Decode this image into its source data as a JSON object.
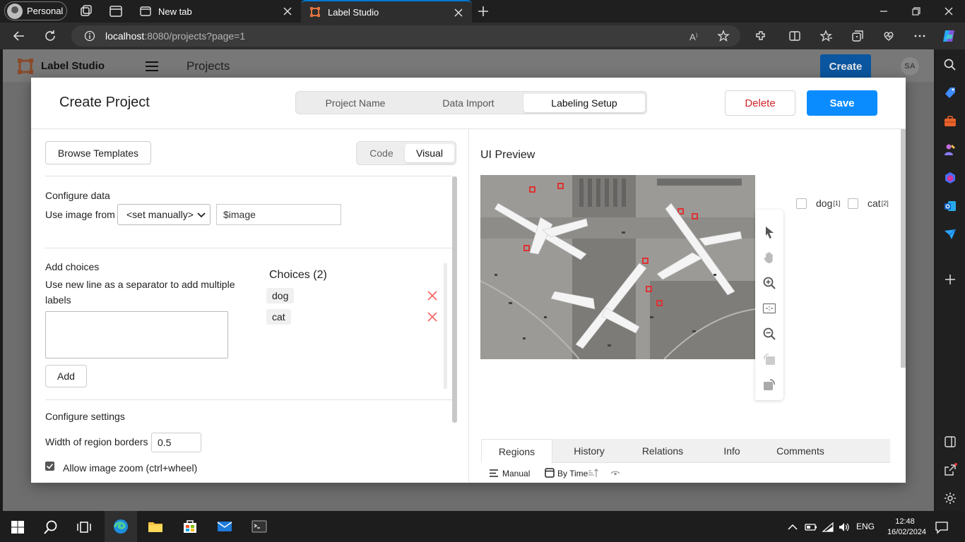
{
  "browser": {
    "profile_label": "Personal",
    "tabs": [
      {
        "title": "New tab",
        "active": false
      },
      {
        "title": "Label Studio",
        "active": true
      }
    ],
    "url_host": "localhost",
    "url_rest": ":8080/projects?page=1"
  },
  "app": {
    "name": "Label Studio",
    "breadcrumb": "Projects",
    "create_label": "Create",
    "user_initials": "SA"
  },
  "modal": {
    "title": "Create Project",
    "steps": [
      "Project Name",
      "Data Import",
      "Labeling Setup"
    ],
    "active_step": "Labeling Setup",
    "delete_label": "Delete",
    "save_label": "Save"
  },
  "setup": {
    "browse_templates": "Browse Templates",
    "mode_code": "Code",
    "mode_visual": "Visual",
    "configure_data_title": "Configure data",
    "use_image_from": "Use image from",
    "source_value": "<set manually>",
    "image_field_value": "$image",
    "add_choices_title": "Add choices",
    "add_choices_help": "Use new line as a separator to add multiple labels",
    "add_button": "Add",
    "choices_title": "Choices (2)",
    "choices": [
      "dog",
      "cat"
    ],
    "configure_settings_title": "Configure settings",
    "width_label": "Width of region borders",
    "width_value": "0.5",
    "zoom_label": "Allow image zoom (ctrl+wheel)"
  },
  "preview": {
    "title": "UI Preview",
    "labels": [
      {
        "name": "dog",
        "hotkey": "[1]"
      },
      {
        "name": "cat",
        "hotkey": "[2]"
      }
    ],
    "panel_tabs": [
      "Regions",
      "History",
      "Relations",
      "Info",
      "Comments"
    ],
    "sort_manual": "Manual",
    "sort_by": "By Time"
  },
  "system": {
    "language": "ENG",
    "time": "12:48",
    "date": "16/02/2024"
  },
  "colors": {
    "accent_blue": "#0a8cff",
    "delete_red": "#d0262d",
    "edge_accent": "#0078d4"
  }
}
